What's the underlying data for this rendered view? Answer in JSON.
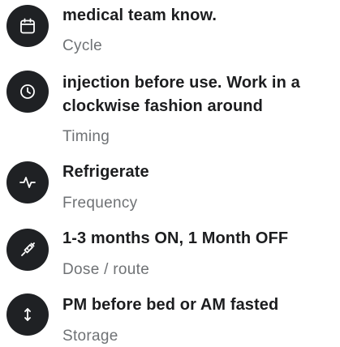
{
  "items": [
    {
      "title": "medical team know.",
      "subtitle": "Cycle",
      "icon": "calendar-icon"
    },
    {
      "title": "injection before use. Work in a clockwise fashion around",
      "subtitle": "Timing",
      "icon": "clock-icon"
    },
    {
      "title": "Refrigerate",
      "subtitle": "Frequency",
      "icon": "pulse-icon"
    },
    {
      "title": "1-3 months ON, 1 Month OFF",
      "subtitle": "Dose / route",
      "icon": "syringe-icon"
    },
    {
      "title": "PM before bed or AM fasted",
      "subtitle": "Storage",
      "icon": "vertical-arrows-icon"
    }
  ],
  "colors": {
    "icon_background": "#1f2124",
    "icon_foreground": "#ffffff",
    "title_text": "#1c1d1f",
    "subtitle_text": "#6f7275"
  }
}
